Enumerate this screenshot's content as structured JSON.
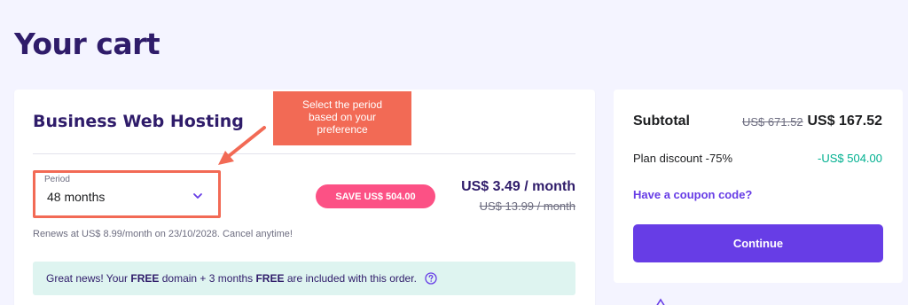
{
  "page": {
    "title": "Your cart"
  },
  "product": {
    "title": "Business Web Hosting",
    "period": {
      "label": "Period",
      "value": "48 months"
    },
    "save_badge": "SAVE US$ 504.00",
    "price": "US$ 3.49 / month",
    "old_price": "US$ 13.99 / month",
    "renews": "Renews at US$ 8.99/month on 23/10/2028. Cancel anytime!",
    "banner": {
      "part1": "Great news! Your ",
      "free1": "FREE",
      "part2": " domain + 3 months ",
      "free2": "FREE",
      "part3": " are included with this order."
    }
  },
  "annotation": {
    "tooltip_line1": "Select the period",
    "tooltip_line2": "based on your",
    "tooltip_line3": "preference"
  },
  "summary": {
    "subtotal_label": "Subtotal",
    "subtotal_old": "US$ 671.52",
    "subtotal_new": "US$ 167.52",
    "discount_label": "Plan discount -75%",
    "discount_value": "-US$ 504.00",
    "coupon_link": "Have a coupon code?",
    "continue_label": "Continue"
  },
  "colors": {
    "primary": "#673de6",
    "heading": "#2f1c6a",
    "badge": "#fc5185",
    "annotation": "#f26a55",
    "success": "#00b090",
    "banner_bg": "#def4f0"
  },
  "icons": {
    "chevron": "chevron-down-icon",
    "help": "help-circle-icon",
    "arrow": "annotation-arrow-icon"
  }
}
